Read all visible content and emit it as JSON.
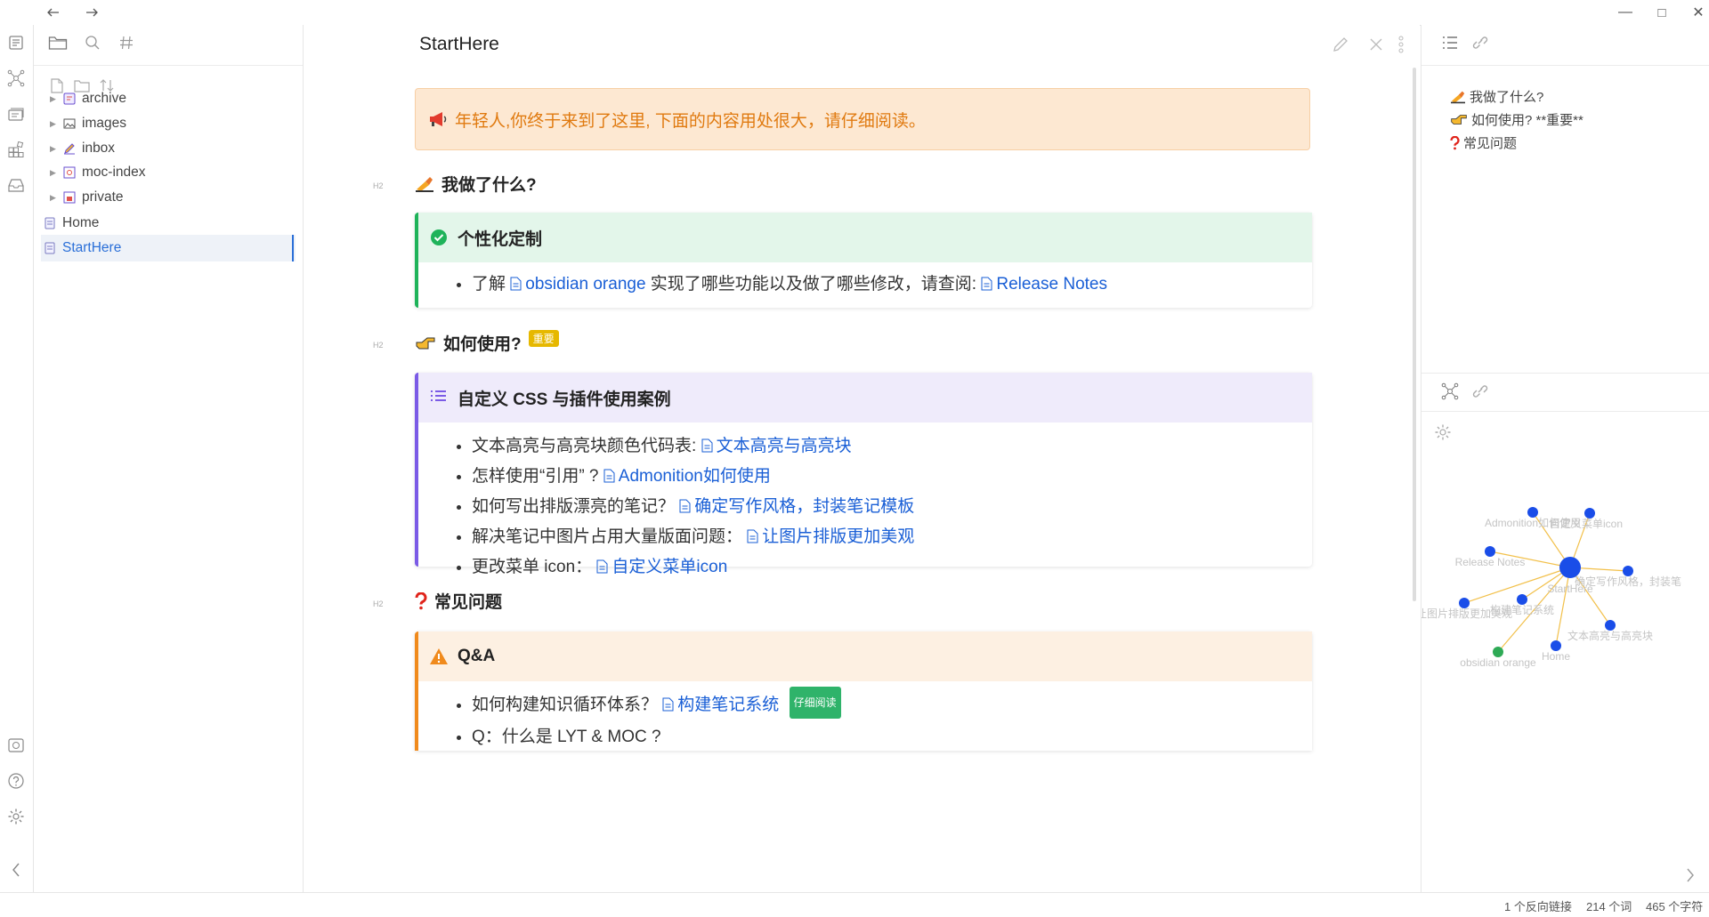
{
  "window": {
    "back_icon": "arrow-left-icon",
    "forward_icon": "arrow-right-icon",
    "minimize": "—",
    "maximize": "□",
    "close": "✕"
  },
  "ribbon": {
    "items": [
      "file-explorer-icon",
      "graph-view-icon",
      "slides-icon",
      "blocks-icon",
      "inbox-icon"
    ],
    "bottom": [
      "vault-icon",
      "help-icon",
      "settings-icon"
    ]
  },
  "explorer": {
    "tree": [
      {
        "label": "archive",
        "type": "folder",
        "icon": "archive-icon"
      },
      {
        "label": "images",
        "type": "folder",
        "icon": "image-icon"
      },
      {
        "label": "inbox",
        "type": "folder",
        "icon": "pencil-icon"
      },
      {
        "label": "moc-index",
        "type": "folder",
        "icon": "moc-icon"
      },
      {
        "label": "private",
        "type": "folder",
        "icon": "lock-doc-icon"
      },
      {
        "label": "Home",
        "type": "file",
        "icon": "note-icon"
      },
      {
        "label": "StartHere",
        "type": "file",
        "icon": "note-icon",
        "active": true
      }
    ]
  },
  "editor": {
    "title": "StartHere",
    "banner": "年轻人,你终于来到了这里, 下面的内容用处很大，请仔细阅读。",
    "banner_icon": "megaphone-icon",
    "section1": {
      "heading": "我做了什么?",
      "callout_title": "个性化定制",
      "item_prefix": "了解",
      "item_link1": "obsidian orange",
      "item_middle": "实现了哪些功能以及做了哪些修改，请查阅:",
      "item_link2": "Release Notes"
    },
    "section2": {
      "heading": "如何使用?",
      "tag": "重要",
      "callout_title": "自定义 CSS 与插件使用案例",
      "items": [
        {
          "text": "文本高亮与高亮块颜色代码表:",
          "link": "文本高亮与高亮块"
        },
        {
          "text": "怎样使用“引用” ?",
          "link": "Admonition如何使用"
        },
        {
          "text": "如何写出排版漂亮的笔记？",
          "link": "确定写作风格，封装笔记模板"
        },
        {
          "text": "解决笔记中图片占用大量版面问题：",
          "link": "让图片排版更加美观"
        },
        {
          "text": "更改菜单 icon：",
          "link": "自定义菜单icon"
        }
      ]
    },
    "section3": {
      "heading": "常见问题",
      "callout_title": "Q&A",
      "items": [
        {
          "text": "如何构建知识循环体系？",
          "link": "构建笔记系统",
          "tag": "仔细阅读"
        },
        {
          "text": "Q：什么是 LYT & MOC ?",
          "link": "",
          "tag": ""
        }
      ]
    },
    "colors": {
      "green": "#1fb35a",
      "purple": "#7b5be6",
      "orange": "#f08a1c",
      "banner_bg": "#fde8d2",
      "link": "#1a5fd6"
    }
  },
  "outline": {
    "items": [
      {
        "icon": "writing-hand-icon",
        "text": "我做了什么?"
      },
      {
        "icon": "pointing-hand-icon",
        "text": "如何使用? **重要**"
      },
      {
        "icon": "question-icon",
        "text": "常见问题"
      }
    ]
  },
  "graph": {
    "center": "StartHere",
    "nodes": [
      {
        "label": "Admonition如何使用"
      },
      {
        "label": "自定义菜单icon"
      },
      {
        "label": "Release Notes"
      },
      {
        "label": "确定写作风格，封装笔"
      },
      {
        "label": "让图片排版更加美观"
      },
      {
        "label": "构建笔记系统"
      },
      {
        "label": "文本高亮与高亮块"
      },
      {
        "label": "Home"
      },
      {
        "label": "obsidian orange"
      }
    ]
  },
  "status": {
    "backlinks": "1 个反向链接",
    "words": "214 个词",
    "chars": "465 个字符"
  }
}
